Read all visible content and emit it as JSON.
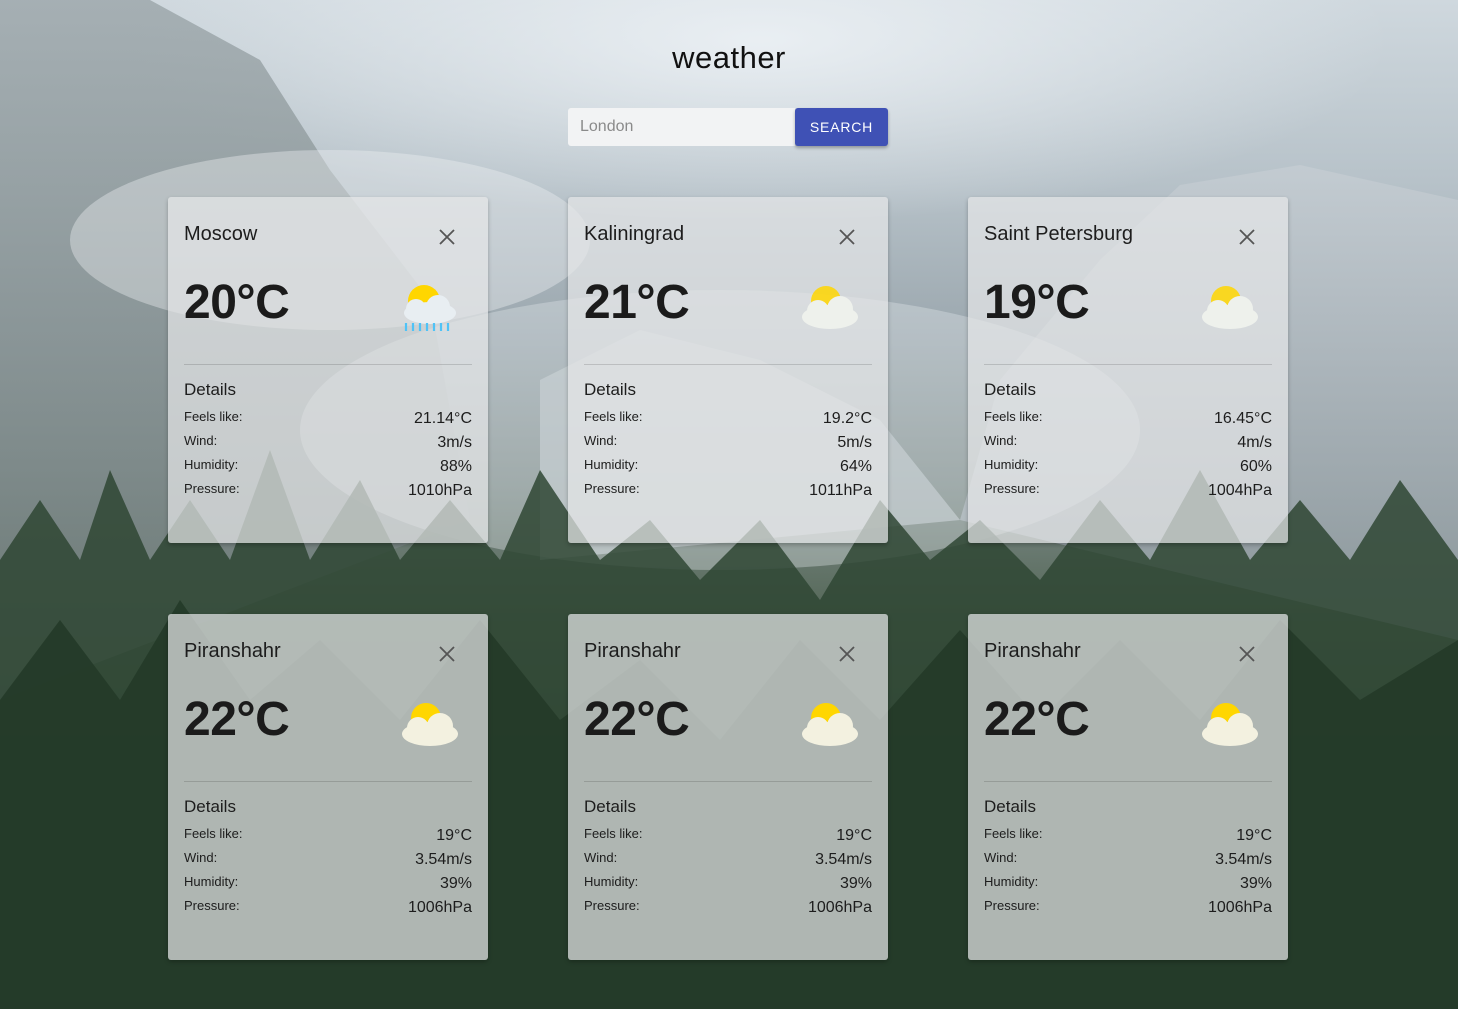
{
  "app": {
    "title": "weather"
  },
  "search": {
    "placeholder": "London",
    "button_label": "SEARCH"
  },
  "colors": {
    "accent": "#3f51b5",
    "sun": "#ffd600",
    "rain": "#4fc3f7"
  },
  "cards": [
    {
      "city": "Moscow",
      "temp": "20°C",
      "icon": "rain-cloud-sun-icon",
      "details_title": "Details",
      "rows": [
        {
          "label": "Feels like:",
          "value": "21.14°C"
        },
        {
          "label": "Wind:",
          "value": "3m/s"
        },
        {
          "label": "Humidity:",
          "value": "88%"
        },
        {
          "label": "Pressure:",
          "value": "1010hPa"
        }
      ]
    },
    {
      "city": "Kaliningrad",
      "temp": "21°C",
      "icon": "cloud-sun-icon",
      "details_title": "Details",
      "rows": [
        {
          "label": "Feels like:",
          "value": "19.2°C"
        },
        {
          "label": "Wind:",
          "value": "5m/s"
        },
        {
          "label": "Humidity:",
          "value": "64%"
        },
        {
          "label": "Pressure:",
          "value": "1011hPa"
        }
      ]
    },
    {
      "city": "Saint Petersburg",
      "temp": "19°C",
      "icon": "cloud-sun-icon",
      "details_title": "Details",
      "rows": [
        {
          "label": "Feels like:",
          "value": "16.45°C"
        },
        {
          "label": "Wind:",
          "value": "4m/s"
        },
        {
          "label": "Humidity:",
          "value": "60%"
        },
        {
          "label": "Pressure:",
          "value": "1004hPa"
        }
      ]
    },
    {
      "city": "Piranshahr",
      "temp": "22°C",
      "icon": "cloud-sun-icon",
      "details_title": "Details",
      "rows": [
        {
          "label": "Feels like:",
          "value": "19°C"
        },
        {
          "label": "Wind:",
          "value": "3.54m/s"
        },
        {
          "label": "Humidity:",
          "value": "39%"
        },
        {
          "label": "Pressure:",
          "value": "1006hPa"
        }
      ]
    },
    {
      "city": "Piranshahr",
      "temp": "22°C",
      "icon": "cloud-sun-icon",
      "details_title": "Details",
      "rows": [
        {
          "label": "Feels like:",
          "value": "19°C"
        },
        {
          "label": "Wind:",
          "value": "3.54m/s"
        },
        {
          "label": "Humidity:",
          "value": "39%"
        },
        {
          "label": "Pressure:",
          "value": "1006hPa"
        }
      ]
    },
    {
      "city": "Piranshahr",
      "temp": "22°C",
      "icon": "cloud-sun-icon",
      "details_title": "Details",
      "rows": [
        {
          "label": "Feels like:",
          "value": "19°C"
        },
        {
          "label": "Wind:",
          "value": "3.54m/s"
        },
        {
          "label": "Humidity:",
          "value": "39%"
        },
        {
          "label": "Pressure:",
          "value": "1006hPa"
        }
      ]
    }
  ]
}
